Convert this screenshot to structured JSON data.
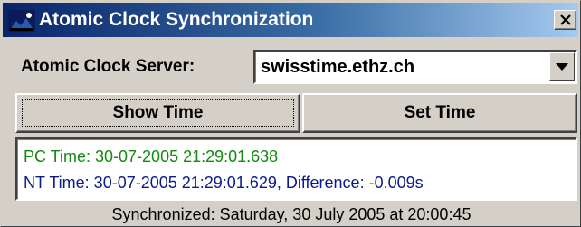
{
  "window": {
    "title": "Atomic Clock Synchronization",
    "close_glyph": "×",
    "colors": {
      "title_start": "#0a246a",
      "title_end": "#a6caf0",
      "face": "#d4d0c8"
    }
  },
  "server": {
    "label": "Atomic Clock Server:",
    "value": "swisstime.ethz.ch",
    "dropdown_icon": "chevron-down-icon"
  },
  "buttons": {
    "show_time": "Show Time",
    "set_time": "Set Time"
  },
  "output": {
    "pc_line": "PC Time: 30-07-2005 21:29:01.638",
    "nt_line": "NT Time: 30-07-2005 21:29:01.629, Difference: -0.009s",
    "pc_color": "#118a11",
    "nt_color": "#0b1b8c"
  },
  "status": {
    "text": "Synchronized: Saturday, 30 July 2005 at 20:00:45"
  }
}
